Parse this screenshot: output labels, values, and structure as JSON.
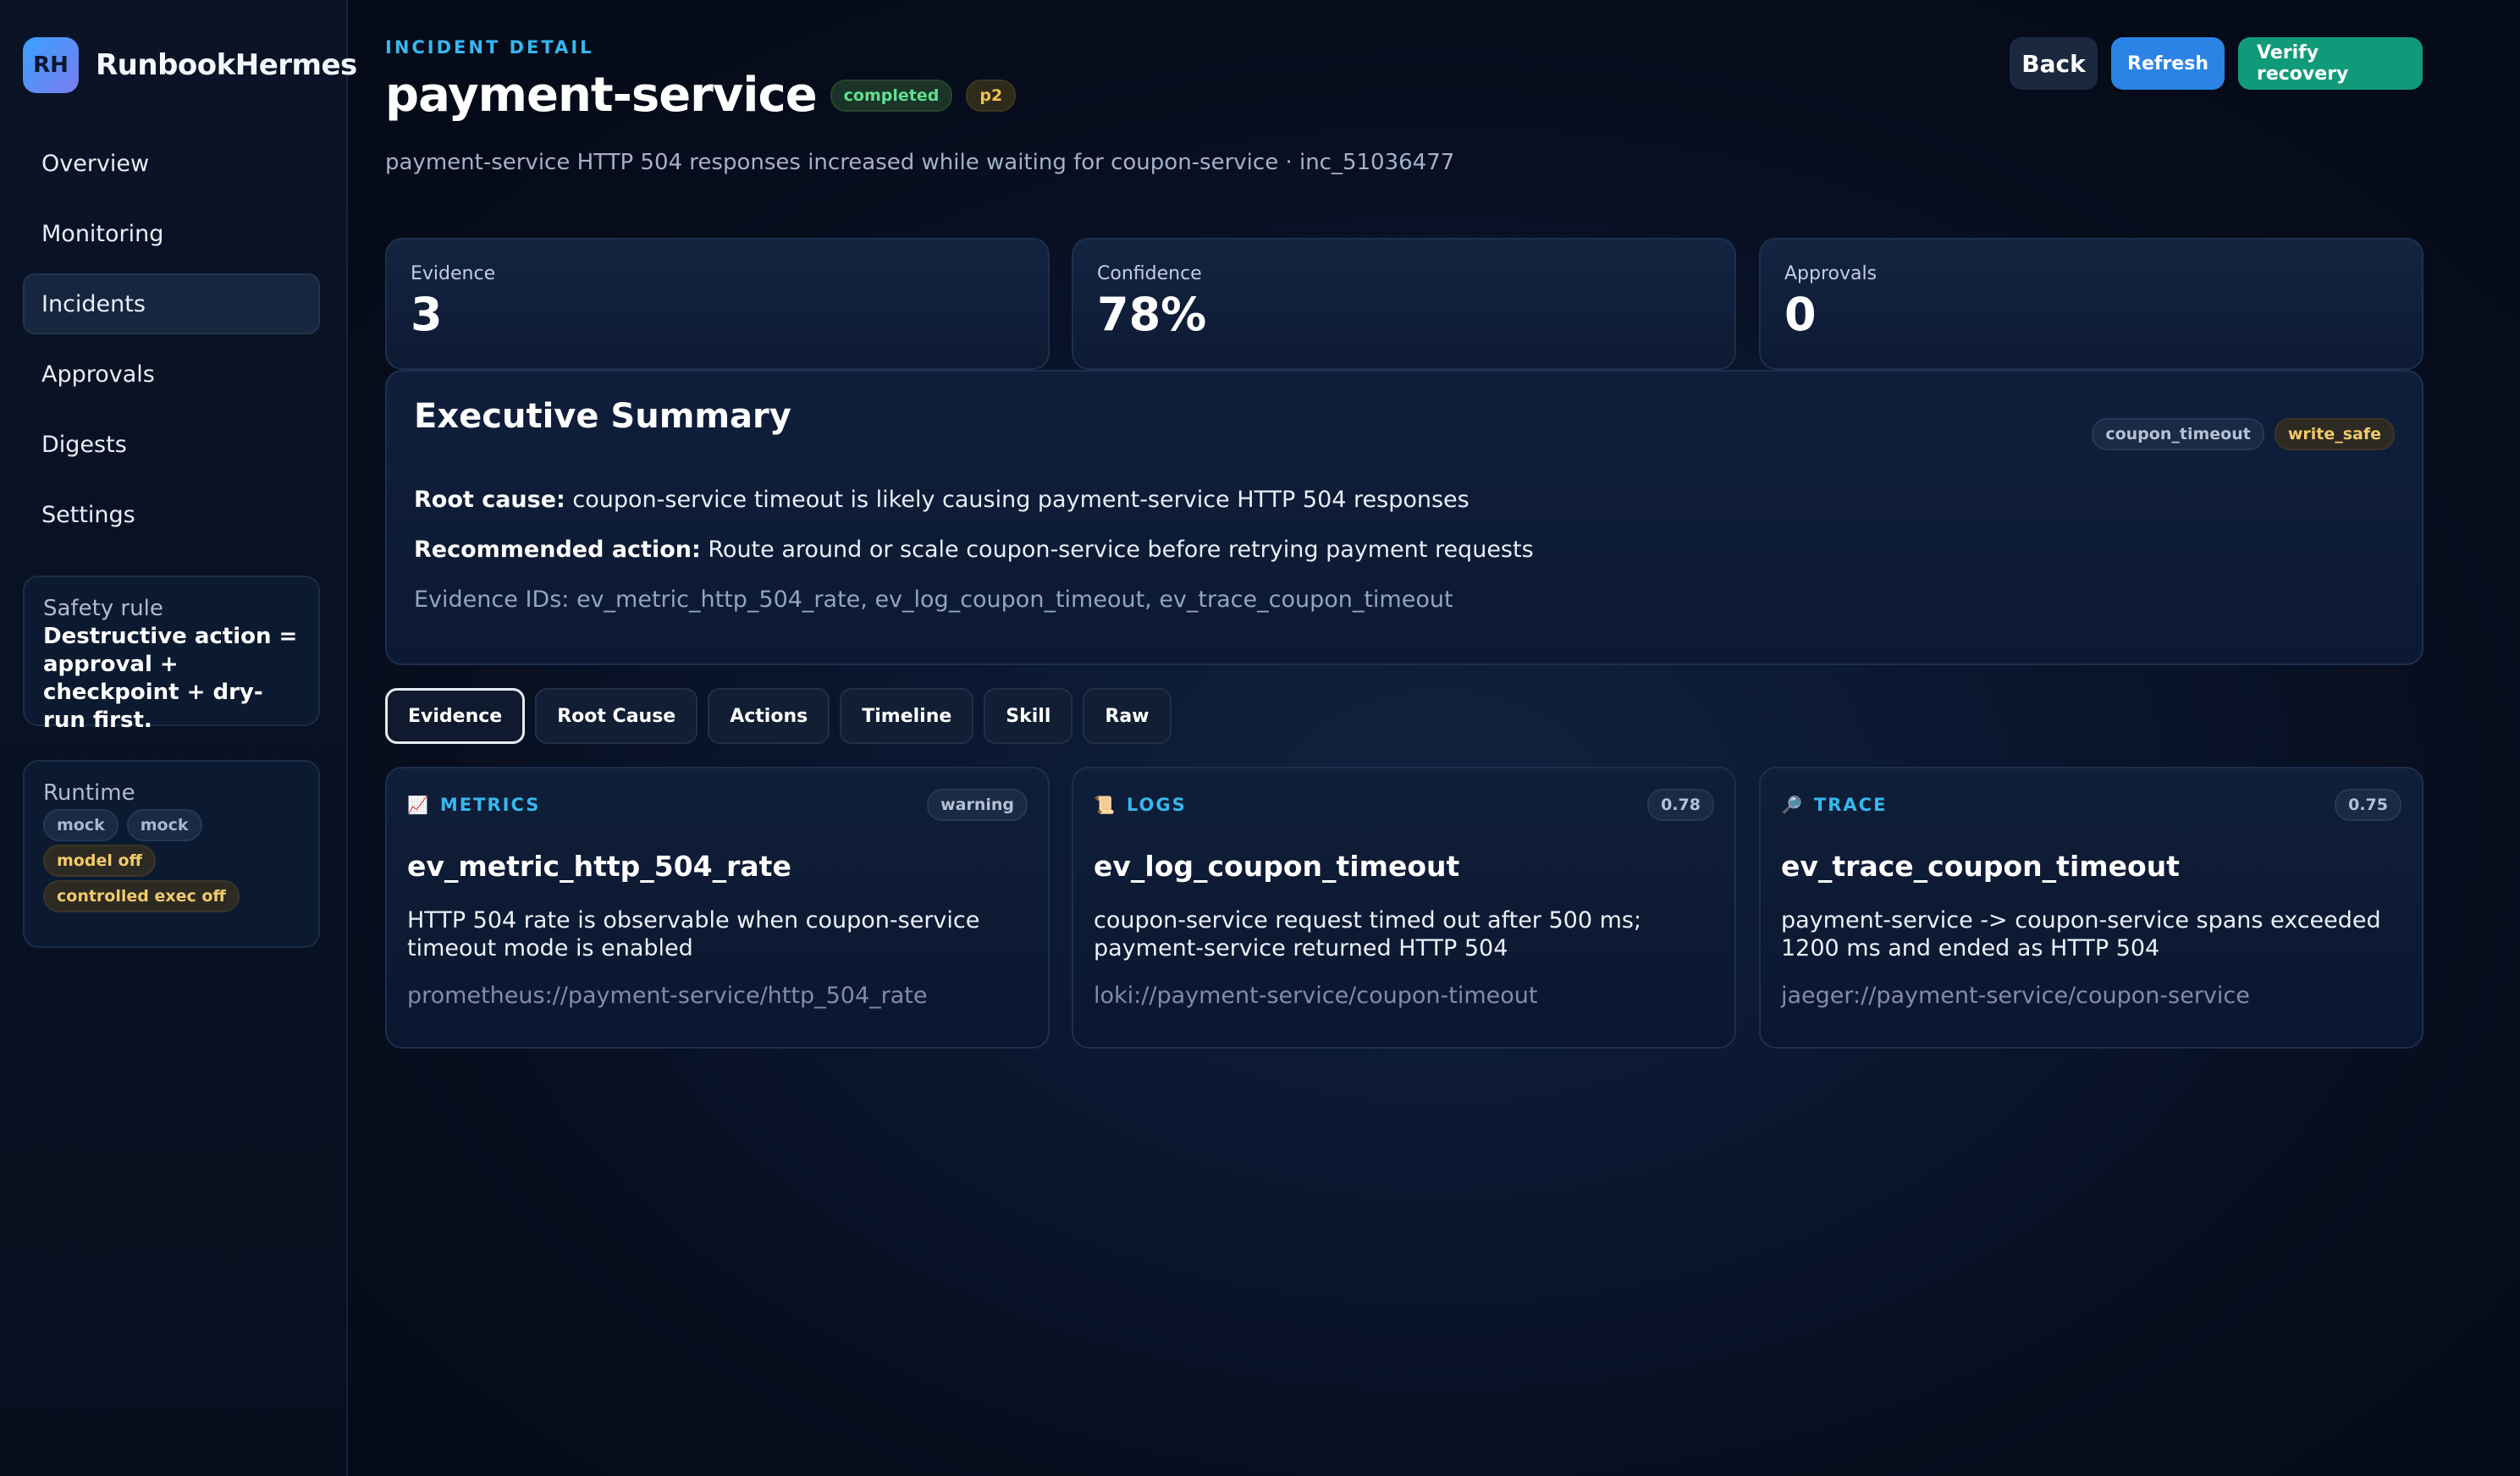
{
  "brand": {
    "logo": "RH",
    "name": "RunbookHermes"
  },
  "nav": [
    {
      "label": "Overview"
    },
    {
      "label": "Monitoring"
    },
    {
      "label": "Incidents"
    },
    {
      "label": "Approvals"
    },
    {
      "label": "Digests"
    },
    {
      "label": "Settings"
    }
  ],
  "active_nav": "Incidents",
  "safety": {
    "title": "Safety rule",
    "text": "Destructive action = approval + checkpoint + dry-run first."
  },
  "runtime": {
    "title": "Runtime",
    "chips": [
      "mock",
      "mock",
      "model off",
      "controlled exec off"
    ]
  },
  "header": {
    "eyebrow": "INCIDENT DETAIL",
    "title": "payment-service",
    "status": "completed",
    "priority": "p2",
    "subtitle": "payment-service HTTP 504 responses increased while waiting for coupon-service · inc_51036477"
  },
  "actions": {
    "back": "Back",
    "refresh": "Refresh",
    "verify": "Verify recovery"
  },
  "stats": [
    {
      "label": "Evidence",
      "value": "3"
    },
    {
      "label": "Confidence",
      "value": "78%"
    },
    {
      "label": "Approvals",
      "value": "0"
    }
  ],
  "summary": {
    "title": "Executive Summary",
    "tags": [
      "coupon_timeout",
      "write_safe"
    ],
    "root_cause_label": "Root cause:",
    "root_cause": "coupon-service timeout is likely causing payment-service HTTP 504 responses",
    "action_label": "Recommended action:",
    "action": "Route around or scale coupon-service before retrying payment requests",
    "evidence_ids": "Evidence IDs: ev_metric_http_504_rate, ev_log_coupon_timeout, ev_trace_coupon_timeout"
  },
  "tabs": [
    "Evidence",
    "Root Cause",
    "Actions",
    "Timeline",
    "Skill",
    "Raw"
  ],
  "active_tab": "Evidence",
  "evidence": [
    {
      "kind": "METRICS",
      "icon": "chart-icon",
      "score": "warning",
      "id": "ev_metric_http_504_rate",
      "desc": "HTTP 504 rate is observable when coupon-service timeout mode is enabled",
      "source": "prometheus://payment-service/http_504_rate"
    },
    {
      "kind": "LOGS",
      "icon": "scroll-icon",
      "score": "0.78",
      "id": "ev_log_coupon_timeout",
      "desc": "coupon-service request timed out after 500 ms; payment-service returned HTTP 504",
      "source": "loki://payment-service/coupon-timeout"
    },
    {
      "kind": "TRACE",
      "icon": "magnifier-icon",
      "score": "0.75",
      "id": "ev_trace_coupon_timeout",
      "desc": "payment-service -> coupon-service spans exceeded 1200 ms and ended as HTTP 504",
      "source": "jaeger://payment-service/coupon-service"
    }
  ]
}
